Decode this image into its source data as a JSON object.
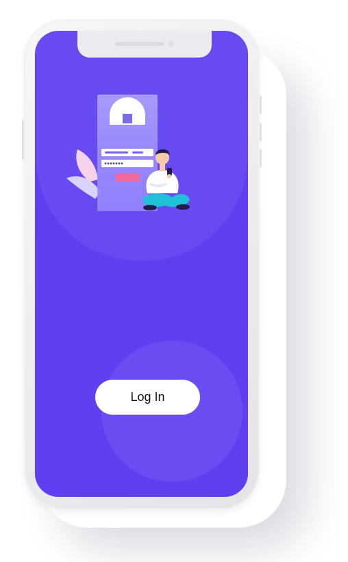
{
  "login_screen": {
    "login_button_label": "Log In"
  },
  "colors": {
    "screen_background": "#5f3ff0",
    "button_background": "#ffffff",
    "device_frame": "#ececf0"
  }
}
